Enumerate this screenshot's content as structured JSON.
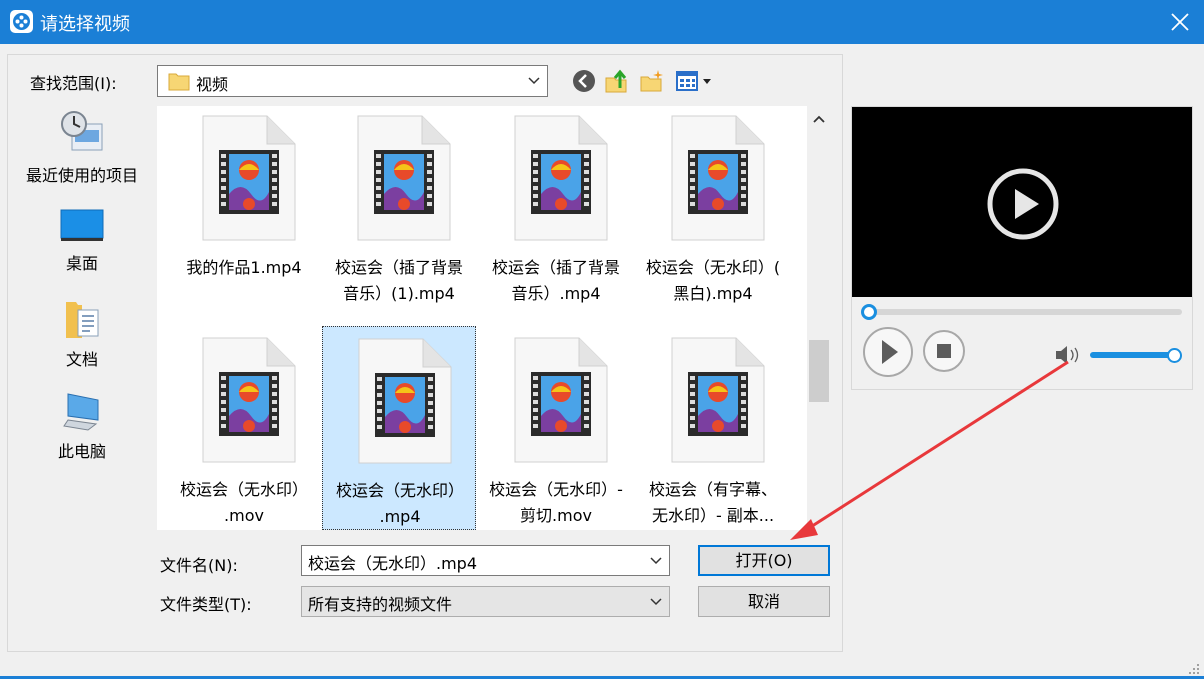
{
  "window": {
    "title": "请选择视频",
    "accent_color": "#1b7fd6"
  },
  "toolbar": {
    "lookin_label": "查找范围(I):",
    "lookin_value": "视频",
    "icons": [
      "back-icon",
      "up-folder-icon",
      "new-folder-icon",
      "view-menu-icon"
    ]
  },
  "places": [
    {
      "label": "最近使用的项目",
      "icon": "recent-icon"
    },
    {
      "label": "桌面",
      "icon": "desktop-icon"
    },
    {
      "label": "文档",
      "icon": "documents-icon"
    },
    {
      "label": "此电脑",
      "icon": "computer-icon"
    }
  ],
  "files": [
    {
      "line1": "我的作品1.mp4",
      "line2": ""
    },
    {
      "line1": "校运会（插了背景",
      "line2": "音乐）(1).mp4"
    },
    {
      "line1": "校运会（插了背景",
      "line2": "音乐）.mp4"
    },
    {
      "line1": "校运会（无水印）(",
      "line2": "黑白).mp4"
    },
    {
      "line1": "校运会（无水印）",
      "line2": ".mov"
    },
    {
      "line1": "校运会（无水印）",
      "line2": ".mp4",
      "selected": true
    },
    {
      "line1": "校运会（无水印）-",
      "line2": "剪切.mov"
    },
    {
      "line1": "校运会（有字幕、",
      "line2": "无水印）- 副本..."
    }
  ],
  "form": {
    "filename_label": "文件名(N):",
    "filename_value": "校运会（无水印）.mp4",
    "filetype_label": "文件类型(T):",
    "filetype_value": "所有支持的视频文件",
    "open_button": "打开(O)",
    "cancel_button": "取消"
  },
  "player": {
    "seek_progress": 0,
    "volume_level": 1.0
  },
  "annotation": {
    "arrow_color": "#e8383b"
  }
}
